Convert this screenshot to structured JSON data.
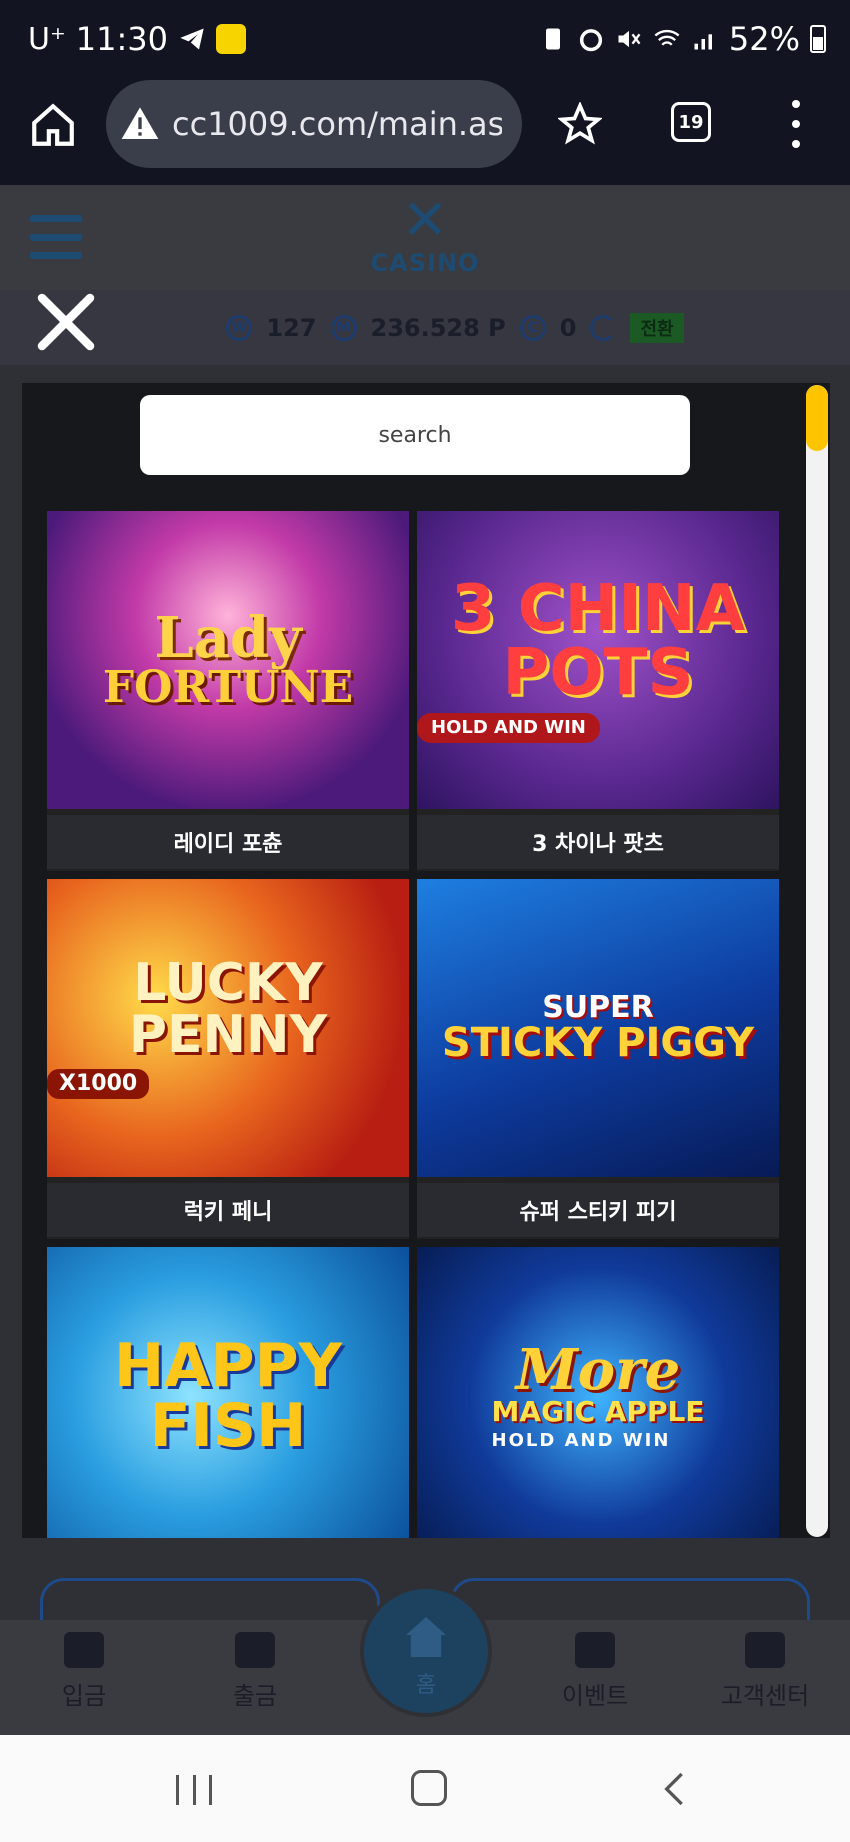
{
  "status_bar": {
    "carrier": "U⁺",
    "time": "11:30",
    "battery_percent": "52%",
    "icons": [
      "telegram-icon",
      "kakao-icon",
      "battery-saver-icon",
      "alarm-icon",
      "mute-icon",
      "wifi-icon",
      "signal-icon",
      "battery-icon"
    ]
  },
  "browser": {
    "url": "cc1009.com/main.as",
    "tab_count": "19",
    "icons": [
      "home-icon",
      "warning-icon",
      "star-icon",
      "tabs-icon",
      "more-vert-icon"
    ]
  },
  "site": {
    "logo_mark": "✕",
    "logo_word": "CASINO",
    "balance": {
      "w_label": "W",
      "w_value": "127",
      "m_label": "M",
      "m_value": "236.528 P",
      "c_label": "C",
      "c_value": "0",
      "badge": "전환"
    }
  },
  "modal": {
    "search_placeholder": "search",
    "games": [
      {
        "thumb_line1": "Lady",
        "thumb_line2": "FORTUNE",
        "label": "레이디 포츈"
      },
      {
        "thumb_line1": "3 CHINA POTS",
        "thumb_line2": "HOLD AND WIN",
        "label": "3 차이나 팟츠"
      },
      {
        "thumb_line1": "LUCKY PENNY",
        "thumb_line2": "X1000",
        "label": "럭키 페니"
      },
      {
        "thumb_line1": "SUPER",
        "thumb_line2": "STICKY PIGGY",
        "label": "슈퍼 스티키 피기"
      },
      {
        "thumb_line1": "HAPPY FISH",
        "thumb_line2": "",
        "label": ""
      },
      {
        "thumb_line1": "More",
        "thumb_line2": "MAGIC APPLE",
        "thumb_line3": "HOLD AND WIN",
        "label": ""
      }
    ]
  },
  "bottom_nav": {
    "items": [
      {
        "label": "입금",
        "icon": "coins-icon"
      },
      {
        "label": "출금",
        "icon": "cash-icon"
      },
      {
        "label": "홈",
        "icon": "home-icon"
      },
      {
        "label": "이벤트",
        "icon": "gift-icon"
      },
      {
        "label": "고객센터",
        "icon": "support-24-icon"
      }
    ]
  },
  "colors": {
    "browser_bg": "#121521",
    "modal_bg": "#17181c",
    "scroll_thumb": "#ffc400",
    "brand_blue": "#1d4b72"
  }
}
